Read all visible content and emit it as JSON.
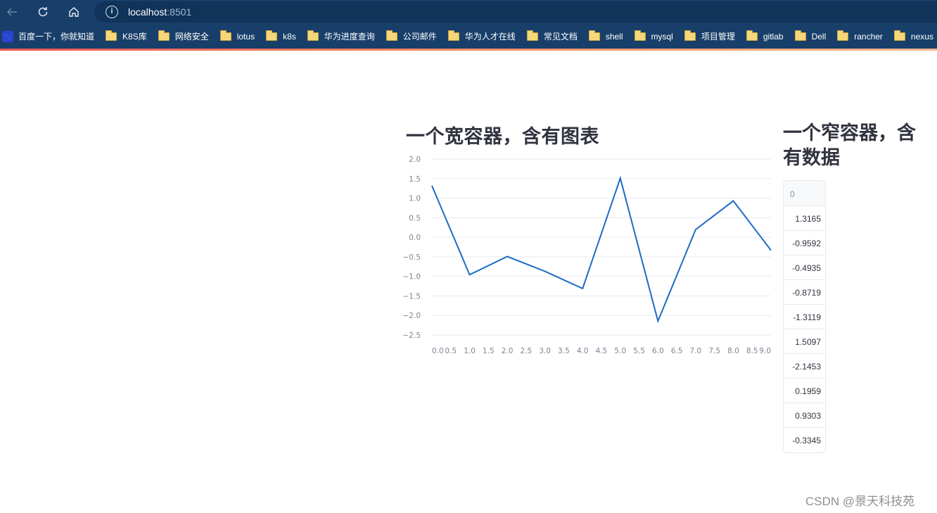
{
  "browser": {
    "url_host": "localhost",
    "url_port": ":8501",
    "nav_icons": [
      "back-arrow-icon",
      "reload-icon",
      "home-icon",
      "info-icon"
    ],
    "bookmarks": [
      {
        "label": "百度一下，你就知道",
        "icon": "baidu-icon"
      },
      {
        "label": "K8S库",
        "icon": "folder-icon"
      },
      {
        "label": "网络安全",
        "icon": "folder-icon"
      },
      {
        "label": "lotus",
        "icon": "folder-icon"
      },
      {
        "label": "k8s",
        "icon": "folder-icon"
      },
      {
        "label": "华为进度查询",
        "icon": "folder-icon"
      },
      {
        "label": "公司邮件",
        "icon": "folder-icon"
      },
      {
        "label": "华为人才在线",
        "icon": "folder-icon"
      },
      {
        "label": "常见文档",
        "icon": "folder-icon"
      },
      {
        "label": "shell",
        "icon": "folder-icon"
      },
      {
        "label": "mysql",
        "icon": "folder-icon"
      },
      {
        "label": "项目管理",
        "icon": "folder-icon"
      },
      {
        "label": "gitlab",
        "icon": "folder-icon"
      },
      {
        "label": "Dell",
        "icon": "folder-icon"
      },
      {
        "label": "rancher",
        "icon": "folder-icon"
      },
      {
        "label": "nexus",
        "icon": "folder-icon"
      }
    ]
  },
  "page": {
    "wide_heading": "一个宽容器，含有图表",
    "narrow_heading": "一个窄容器，含有数据",
    "table": {
      "header": "0",
      "rows": [
        "1.3165",
        "-0.9592",
        "-0.4935",
        "-0.8719",
        "-1.3119",
        "1.5097",
        "-2.1453",
        "0.1959",
        "0.9303",
        "-0.3345"
      ]
    },
    "watermark": "CSDN @景天科技苑"
  },
  "chart_data": {
    "type": "line",
    "title": "",
    "xlabel": "",
    "ylabel": "",
    "x": [
      0,
      1,
      2,
      3,
      4,
      5,
      6,
      7,
      8,
      9
    ],
    "series": [
      {
        "name": "0",
        "color": "#1c6bc4",
        "values": [
          1.3165,
          -0.9592,
          -0.4935,
          -0.8719,
          -1.3119,
          1.5097,
          -2.1453,
          0.1959,
          0.9303,
          -0.3345
        ]
      }
    ],
    "xlim": [
      0,
      9
    ],
    "ylim": [
      -2.5,
      2.0
    ],
    "x_ticks": [
      "0.0",
      "0.5",
      "1.0",
      "1.5",
      "2.0",
      "2.5",
      "3.0",
      "3.5",
      "4.0",
      "4.5",
      "5.0",
      "5.5",
      "6.0",
      "6.5",
      "7.0",
      "7.5",
      "8.0",
      "8.5",
      "9.0"
    ],
    "y_ticks": [
      "2.0",
      "1.5",
      "1.0",
      "0.5",
      "0.0",
      "−0.5",
      "−1.0",
      "−1.5",
      "−2.0",
      "−2.5"
    ],
    "grid": true,
    "legend": "none"
  }
}
